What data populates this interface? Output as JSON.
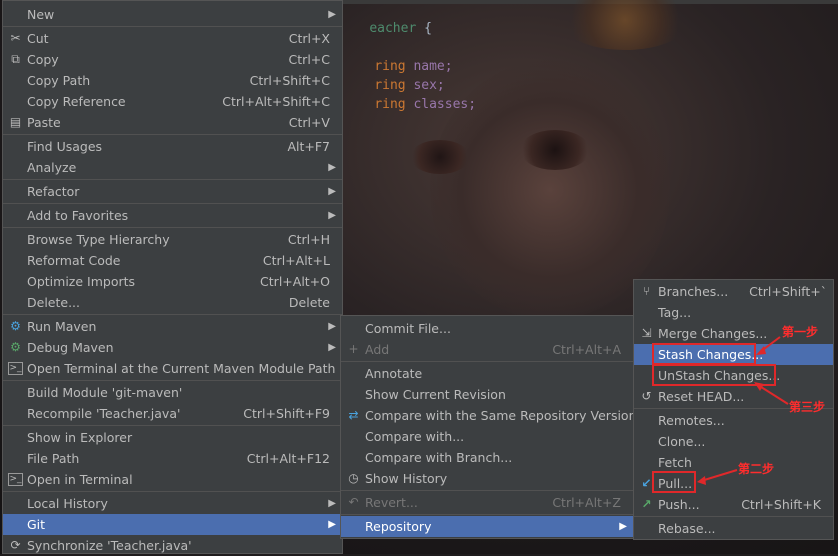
{
  "editor": {
    "class_line": {
      "prefix": "",
      "name": "eacher",
      "suffix": " {"
    },
    "fields": [
      {
        "type": "ring",
        "name": "name;"
      },
      {
        "type": "ring",
        "name": "sex;"
      },
      {
        "type": "ring",
        "name": "classes;"
      }
    ]
  },
  "context_menu": {
    "items": [
      {
        "label": "New",
        "shortcut": "",
        "arrow": "▶"
      },
      {
        "label": "Cut",
        "shortcut": "Ctrl+X",
        "icon": "✂"
      },
      {
        "label": "Copy",
        "shortcut": "Ctrl+C",
        "icon": "⧉"
      },
      {
        "label": "Copy Path",
        "shortcut": "Ctrl+Shift+C"
      },
      {
        "label": "Copy Reference",
        "shortcut": "Ctrl+Alt+Shift+C"
      },
      {
        "label": "Paste",
        "shortcut": "Ctrl+V",
        "icon": "▤"
      },
      {
        "label": "Find Usages",
        "shortcut": "Alt+F7"
      },
      {
        "label": "Analyze",
        "arrow": "▶"
      },
      {
        "label": "Refactor",
        "arrow": "▶"
      },
      {
        "label": "Add to Favorites",
        "arrow": "▶"
      },
      {
        "label": "Browse Type Hierarchy",
        "shortcut": "Ctrl+H"
      },
      {
        "label": "Reformat Code",
        "shortcut": "Ctrl+Alt+L"
      },
      {
        "label": "Optimize Imports",
        "shortcut": "Ctrl+Alt+O"
      },
      {
        "label": "Delete...",
        "shortcut": "Delete"
      },
      {
        "label": "Run Maven",
        "arrow": "▶",
        "icon": "⚙"
      },
      {
        "label": "Debug Maven",
        "arrow": "▶",
        "icon": "⚙"
      },
      {
        "label": "Open Terminal at the Current Maven Module Path",
        "icon": ">_"
      },
      {
        "label": "Build Module 'git-maven'"
      },
      {
        "label": "Recompile 'Teacher.java'",
        "shortcut": "Ctrl+Shift+F9"
      },
      {
        "label": "Show in Explorer"
      },
      {
        "label": "File Path",
        "shortcut": "Ctrl+Alt+F12"
      },
      {
        "label": "Open in Terminal",
        "icon": ">_"
      },
      {
        "label": "Local History",
        "arrow": "▶"
      },
      {
        "label": "Git",
        "arrow": "▶"
      },
      {
        "label": "Synchronize 'Teacher.java'",
        "icon": "⟳"
      }
    ]
  },
  "git_menu": {
    "items": [
      {
        "label": "Commit File..."
      },
      {
        "label": "Add",
        "shortcut": "Ctrl+Alt+A",
        "icon": "+"
      },
      {
        "label": "Annotate"
      },
      {
        "label": "Show Current Revision"
      },
      {
        "label": "Compare with the Same Repository Version",
        "icon": "⇄"
      },
      {
        "label": "Compare with..."
      },
      {
        "label": "Compare with Branch..."
      },
      {
        "label": "Show History",
        "icon": "◷"
      },
      {
        "label": "Revert...",
        "shortcut": "Ctrl+Alt+Z",
        "icon": "↶"
      },
      {
        "label": "Repository",
        "arrow": "▶"
      }
    ]
  },
  "repository_menu": {
    "items": [
      {
        "label": "Branches...",
        "shortcut": "Ctrl+Shift+`",
        "icon": "⑂"
      },
      {
        "label": "Tag..."
      },
      {
        "label": "Merge Changes...",
        "icon": "⇲"
      },
      {
        "label": "Stash Changes..."
      },
      {
        "label": "UnStash Changes..."
      },
      {
        "label": "Reset HEAD...",
        "icon": "↺"
      },
      {
        "label": "Remotes..."
      },
      {
        "label": "Clone..."
      },
      {
        "label": "Fetch"
      },
      {
        "label": "Pull...",
        "icon": "↙"
      },
      {
        "label": "Push...",
        "shortcut": "Ctrl+Shift+K",
        "icon": "↗"
      },
      {
        "label": "Rebase..."
      }
    ]
  },
  "annotations": {
    "step1": "第一步",
    "step2": "第二步",
    "step3": "第三步"
  },
  "colors": {
    "menu_bg": "#3c3f41",
    "selection": "#4b6eaf",
    "annotation_red": "#e0282a"
  }
}
